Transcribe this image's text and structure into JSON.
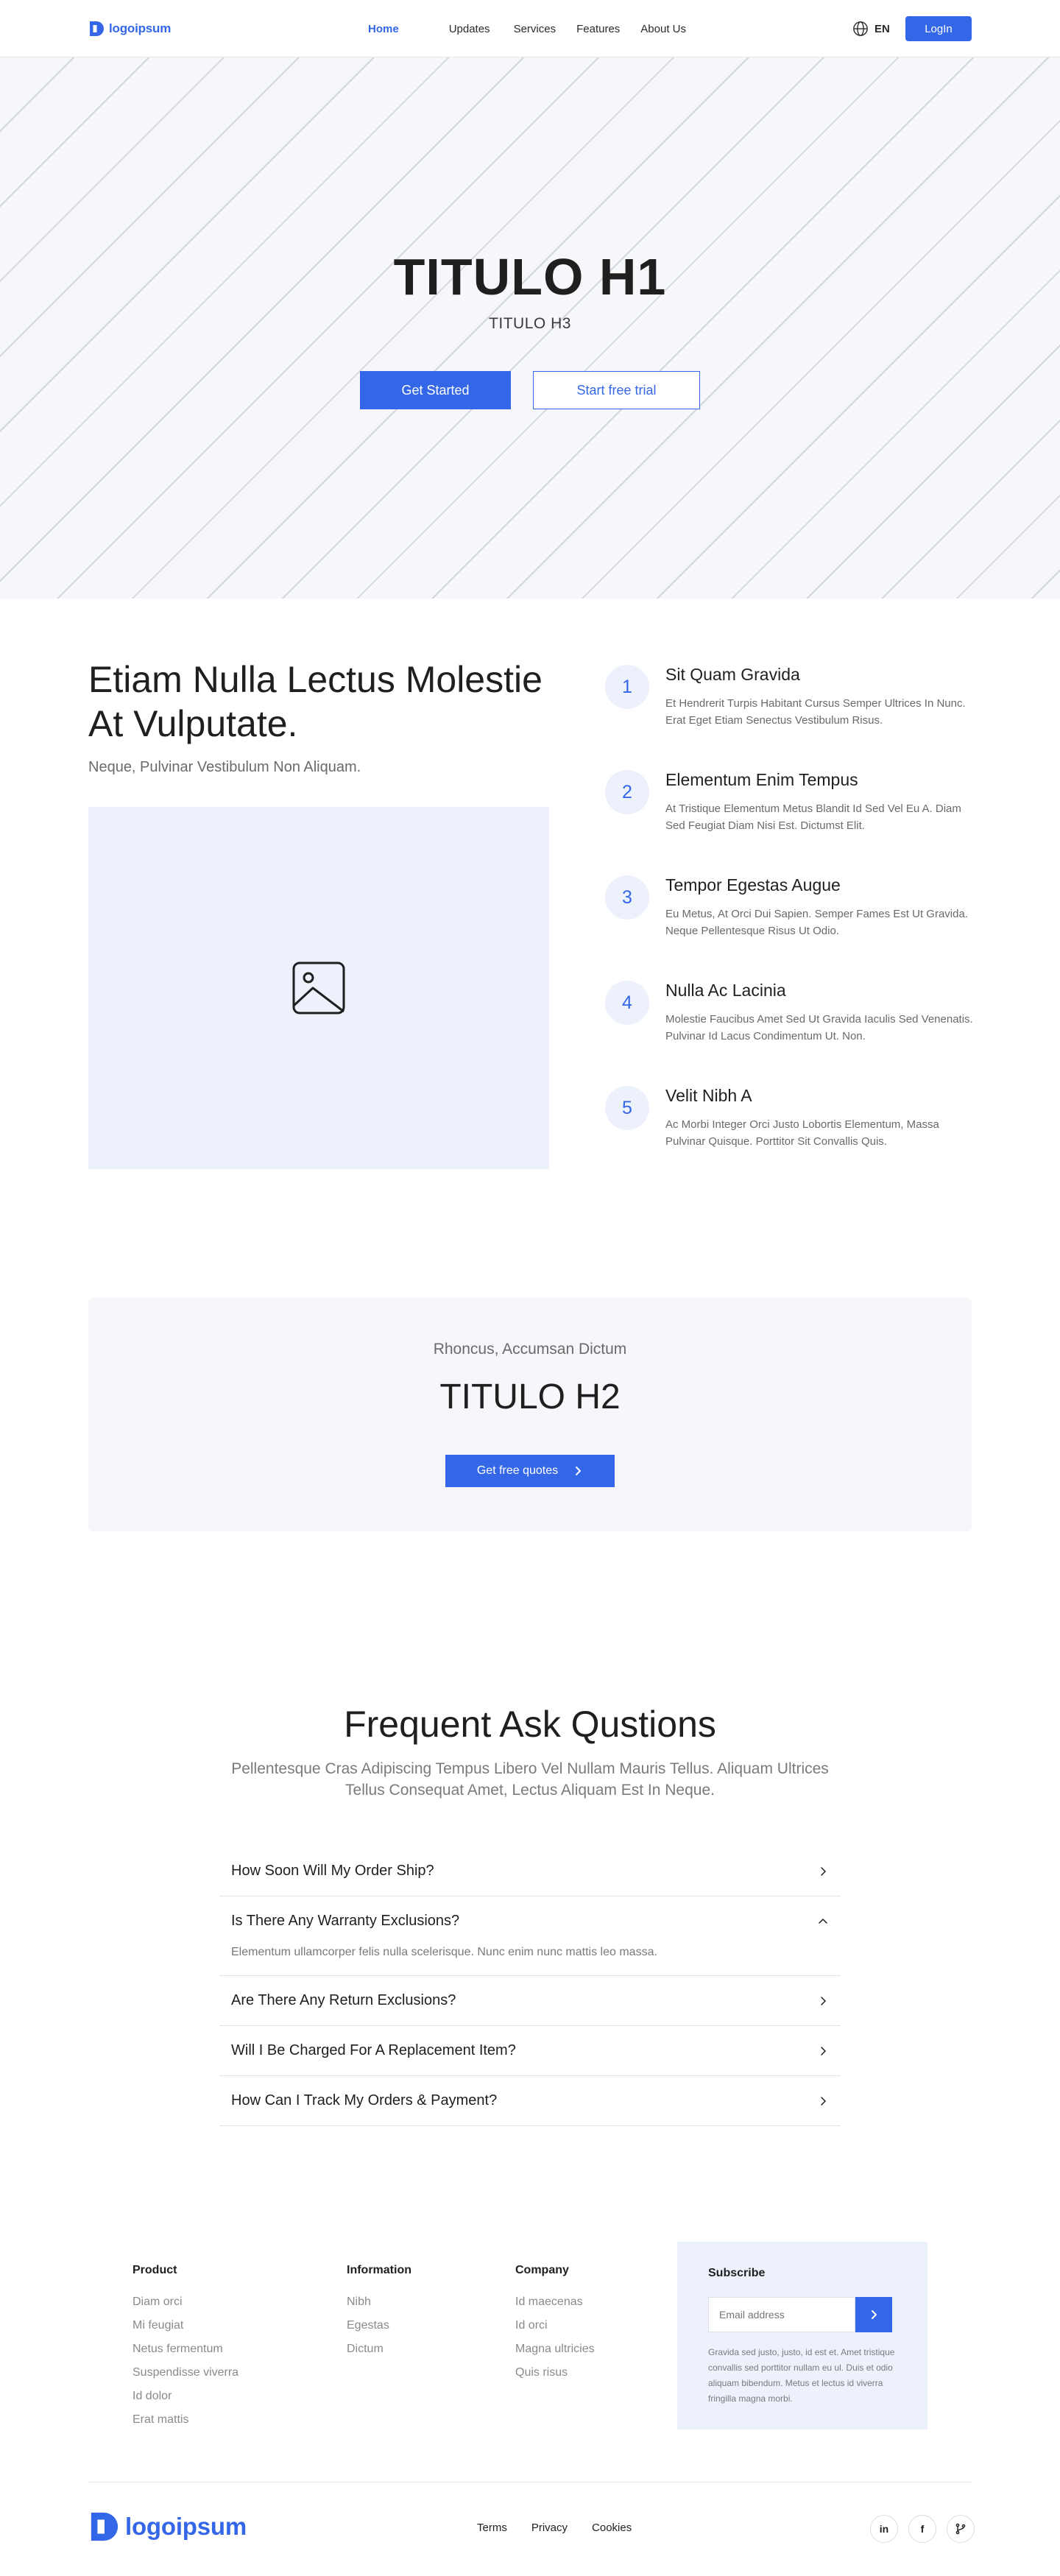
{
  "brand": {
    "name": "logoipsum",
    "accent": "#3466e8"
  },
  "nav": {
    "links": [
      {
        "label": "Home",
        "active": true
      },
      {
        "label": "Updates",
        "active": false
      },
      {
        "label": "Services",
        "active": false
      },
      {
        "label": "Features",
        "active": false
      },
      {
        "label": "About Us",
        "active": false
      }
    ],
    "lang": {
      "icon": "globe-icon",
      "label": "EN"
    },
    "login_label": "LogIn"
  },
  "hero": {
    "title": "TITULO H1",
    "subtitle": "TITULO H3",
    "primary_button": "Get Started",
    "secondary_button": "Start free trial"
  },
  "features": {
    "title": "Etiam Nulla Lectus Molestie At Vulputate.",
    "subtitle": "Neque, Pulvinar Vestibulum Non Aliquam.",
    "image_icon": "image-placeholder-icon",
    "steps": [
      {
        "num": "1",
        "title": "Sit Quam Gravida",
        "desc": "Et Hendrerit Turpis Habitant Cursus Semper Ultrices In Nunc. Erat Eget Etiam Senectus Vestibulum Risus."
      },
      {
        "num": "2",
        "title": "Elementum Enim Tempus",
        "desc": "At Tristique Elementum Metus Blandit Id Sed Vel Eu A. Diam Sed Feugiat Diam Nisi Est. Dictumst Elit."
      },
      {
        "num": "3",
        "title": "Tempor Egestas Augue",
        "desc": "Eu Metus, At Orci Dui Sapien. Semper Fames Est Ut Gravida. Neque Pellentesque Risus Ut Odio."
      },
      {
        "num": "4",
        "title": "Nulla Ac Lacinia",
        "desc": "Molestie Faucibus Amet Sed Ut Gravida Iaculis Sed Venenatis. Pulvinar Id Lacus Condimentum Ut. Non."
      },
      {
        "num": "5",
        "title": "Velit Nibh A",
        "desc": "Ac Morbi Integer Orci Justo Lobortis Elementum, Massa Pulvinar Quisque. Porttitor Sit Convallis Quis."
      }
    ]
  },
  "cta": {
    "kicker": "Rhoncus, Accumsan Dictum",
    "title": "TITULO H2",
    "button": "Get free quotes"
  },
  "faq": {
    "title": "Frequent Ask Qustions",
    "subtitle": "Pellentesque Cras Adipiscing Tempus Libero Vel Nullam Mauris Tellus. Aliquam Ultrices Tellus Consequat Amet, Lectus Aliquam Est In Neque.",
    "items": [
      {
        "question": "How Soon Will My Order Ship?",
        "expanded": false,
        "answer": ""
      },
      {
        "question": "Is There Any Warranty Exclusions?",
        "expanded": true,
        "answer": "Elementum ullamcorper felis nulla scelerisque. Nunc enim nunc mattis leo massa."
      },
      {
        "question": "Are There Any Return Exclusions?",
        "expanded": false,
        "answer": ""
      },
      {
        "question": "Will I Be Charged For A Replacement Item?",
        "expanded": false,
        "answer": ""
      },
      {
        "question": "How Can I Track My Orders & Payment?",
        "expanded": false,
        "answer": ""
      }
    ]
  },
  "footer": {
    "columns": [
      {
        "heading": "Product",
        "links": [
          "Diam orci",
          "Mi feugiat",
          "Netus fermentum",
          "Suspendisse viverra",
          "Id dolor",
          "Erat mattis"
        ]
      },
      {
        "heading": "Information",
        "links": [
          "Nibh",
          "Egestas",
          "Dictum"
        ]
      },
      {
        "heading": "Company",
        "links": [
          "Id maecenas",
          "Id orci",
          "Magna ultricies",
          "Quis risus"
        ]
      }
    ],
    "subscribe": {
      "heading": "Subscribe",
      "placeholder": "Email address",
      "text": "Gravida sed justo, justo, id est et. Amet tristique convallis sed porttitor nullam eu ul. Duis et odio aliquam bibendum. Metus et lectus id viverra fringilla magna morbi."
    },
    "links": [
      "Terms",
      "Privacy",
      "Cookies"
    ],
    "socials": [
      {
        "name": "linkedin-icon",
        "label": "in"
      },
      {
        "name": "facebook-icon",
        "label": "f"
      },
      {
        "name": "git-branch-icon",
        "label": ""
      }
    ]
  }
}
